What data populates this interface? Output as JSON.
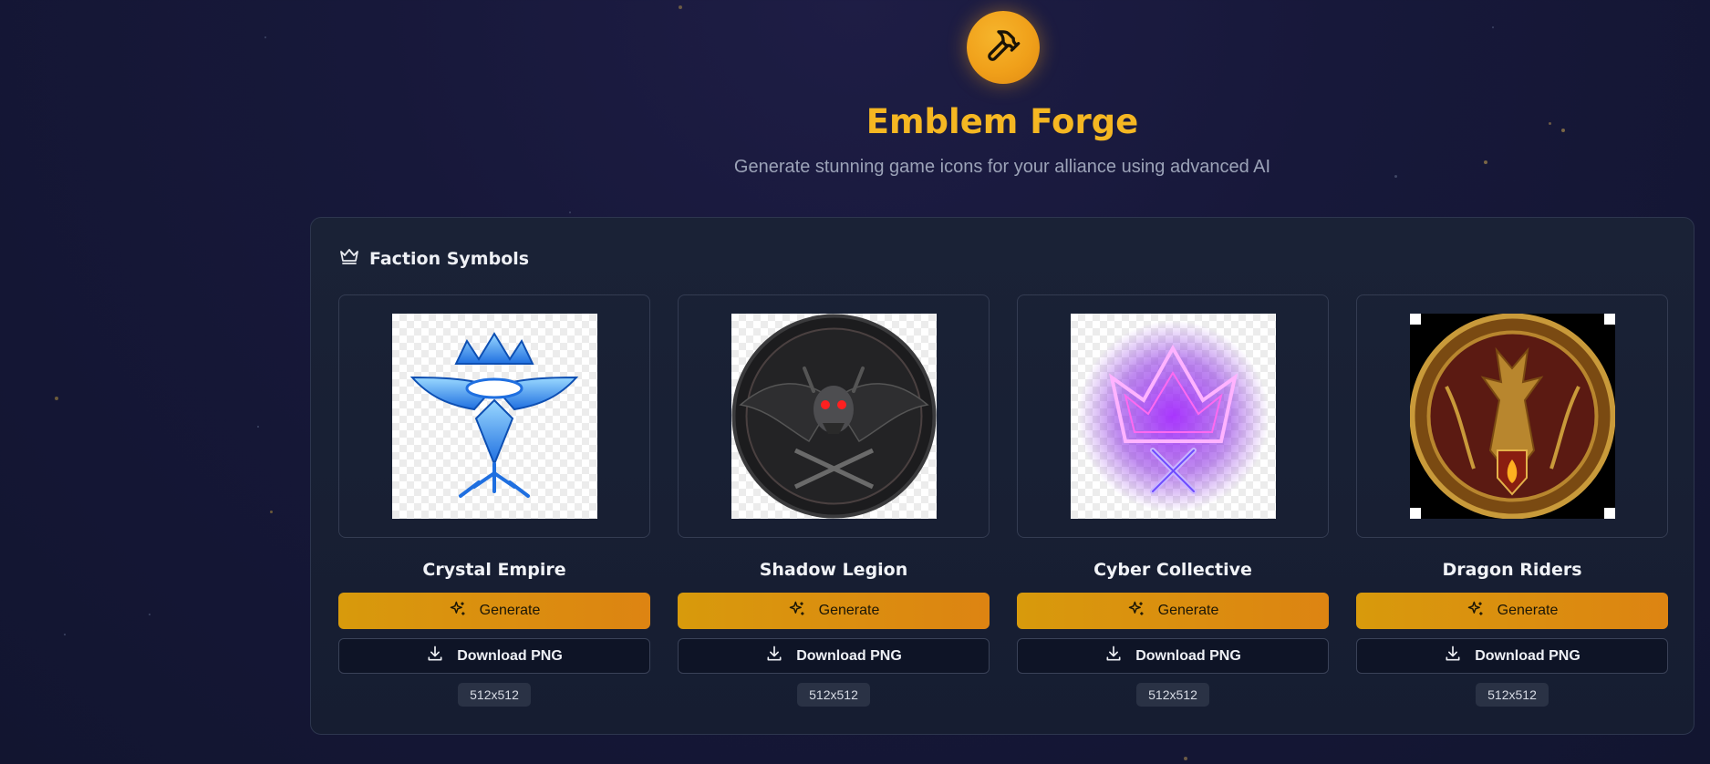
{
  "header": {
    "logo_icon": "hammer-icon",
    "title": "Emblem Forge",
    "subtitle": "Generate stunning game icons for your alliance using advanced AI"
  },
  "section": {
    "icon": "crown-icon",
    "title": "Faction Symbols"
  },
  "cards": [
    {
      "name": "Crystal Empire",
      "generate_label": "Generate",
      "download_label": "Download PNG",
      "size": "512x512",
      "image": "crystal-eagle-emblem"
    },
    {
      "name": "Shadow Legion",
      "generate_label": "Generate",
      "download_label": "Download PNG",
      "size": "512x512",
      "image": "skull-wings-emblem"
    },
    {
      "name": "Cyber Collective",
      "generate_label": "Generate",
      "download_label": "Download PNG",
      "size": "512x512",
      "image": "neon-crown-emblem"
    },
    {
      "name": "Dragon Riders",
      "generate_label": "Generate",
      "download_label": "Download PNG",
      "size": "512x512",
      "image": "dragon-shield-emblem"
    }
  ],
  "colors": {
    "accent": "#f5b722",
    "button_gradient_start": "#d89a0c",
    "button_gradient_end": "#dd8412",
    "background": "#17183a"
  }
}
